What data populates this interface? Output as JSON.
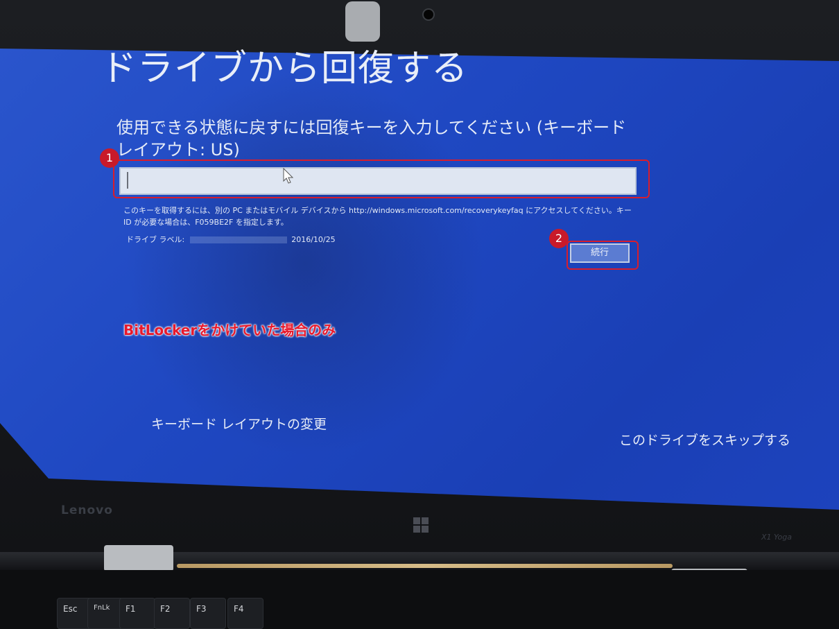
{
  "screen": {
    "title": "ドライブから回復する",
    "prompt": "使用できる状態に戻すには回復キーを入力してください (キーボード レイアウト: US)",
    "key_input_value": "",
    "help_text": "このキーを取得するには、別の PC またはモバイル デバイスから http://windows.microsoft.com/recoverykeyfaq にアクセスしてください。キー ID が必要な場合は、F059BE2F を指定します。",
    "drive_label": "ドライブ ラベル:",
    "drive_date": "2016/10/25",
    "continue_label": "続行",
    "keyboard_layout_link": "キーボード レイアウトの変更",
    "skip_link": "このドライブをスキップする"
  },
  "annotations": {
    "badge_1": "1",
    "badge_2": "2",
    "note": "BitLockerをかけていた場合のみ",
    "color": "#d81d2c"
  },
  "hardware": {
    "brand": "Lenovo",
    "model": "X1 Yoga",
    "keys": [
      "Esc",
      "FnLk",
      "F1",
      "F2",
      "F3",
      "F4"
    ]
  }
}
